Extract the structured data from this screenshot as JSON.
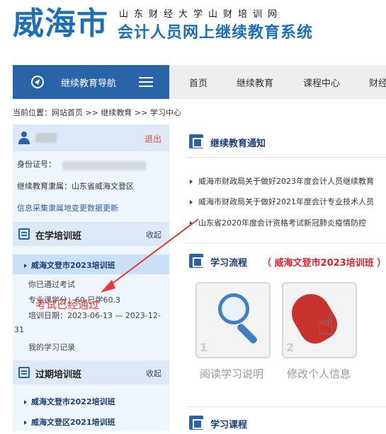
{
  "header": {
    "city": "威海市",
    "subtitle_top": "山东财经大学山财培训网",
    "subtitle_main": "会计人员网上继续教育系统"
  },
  "nav": {
    "guide_label": "继续教育导航",
    "items": [
      "首页",
      "继续教育",
      "课程中心",
      "财经"
    ]
  },
  "breadcrumb": "当前位置：网站首页 >> 继续教育 >> 学习中心",
  "user_panel": {
    "logout": "退出",
    "id_label": "身份证号：",
    "affiliation": "继续教育隶属：山东省威海文登区",
    "update_link": "信息采集隶属地变更数据更新"
  },
  "current_classes": {
    "title": "在学培训班",
    "toggle": "收起",
    "active_class": "威海文登市2023培训班",
    "status": "你已通过考试",
    "credits": "专业课学分：60 已学60.3",
    "date": "培训日期：2023-06-13 — 2023-12-",
    "date_wrap": "31",
    "record": "我的学习记录"
  },
  "past_classes": {
    "title": "过期培训班",
    "toggle": "收起",
    "items": [
      "威海文登市2022培训班",
      "威海文登区2021培训班"
    ]
  },
  "notice_panel": {
    "title": "继续教育通知",
    "items": [
      "威海市财政局关于做好2023年度会计人员继续教育",
      "威海市财政局关于做好2021年度会计专业技术人员",
      "山东省2020年度会计资格考试新冠肺炎疫情防控"
    ]
  },
  "process_panel": {
    "title": "学习流程",
    "class_name": "（ 威海文登市2023培训班 ）",
    "steps": [
      {
        "num": "1",
        "label": "阅读学习说明"
      },
      {
        "num": "2",
        "label": "修改个人信息"
      }
    ]
  },
  "course_panel": {
    "title": "学习课程"
  },
  "annotation": {
    "text": "考试已经通过",
    "color": "#e83a30"
  },
  "colors": {
    "brand_blue": "#2a64a8",
    "accent_red": "#e0222a"
  }
}
